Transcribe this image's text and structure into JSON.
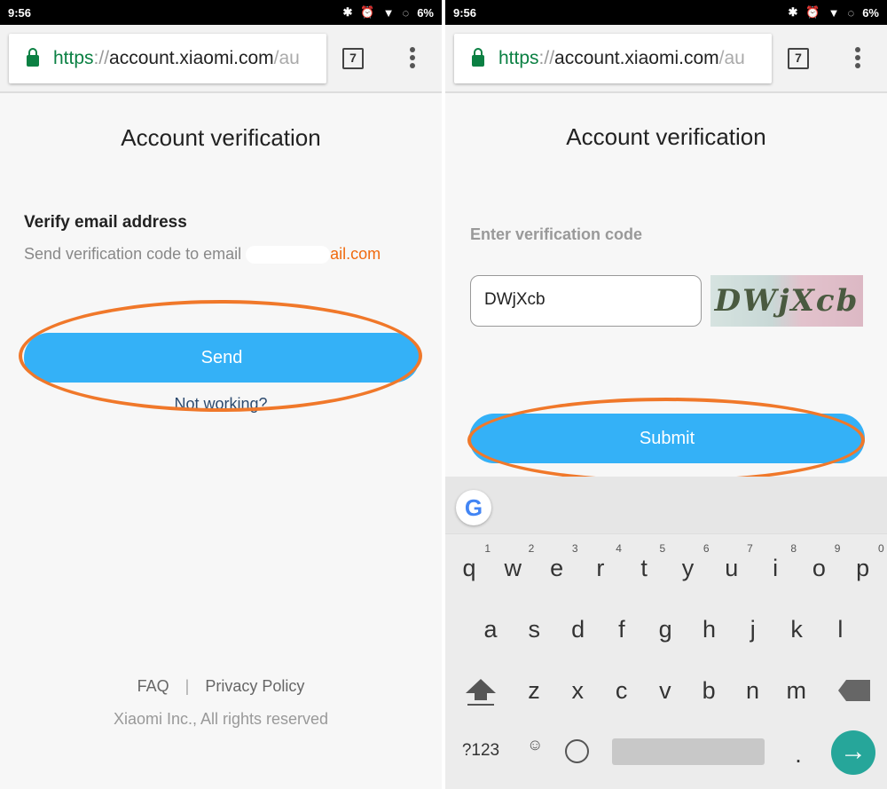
{
  "status": {
    "time": "9:56",
    "battery": "6%"
  },
  "browser": {
    "url_scheme": "https",
    "url_sep": "://",
    "url_host": "account.xiaomi.com",
    "url_rest": "/au",
    "tab_count": "7"
  },
  "left": {
    "title": "Account verification",
    "heading": "Verify email address",
    "desc": "Send verification code to email ",
    "email_visible": "ail.com",
    "send": "Send",
    "not_working": "Not working?",
    "faq": "FAQ",
    "divider": "|",
    "privacy": "Privacy Policy",
    "copyright": "Xiaomi Inc., All rights reserved"
  },
  "right": {
    "title": "Account verification",
    "label": "Enter verification code",
    "code_value": "DWjXcb",
    "captcha_text": "DWjXcb",
    "submit": "Submit"
  },
  "keyboard": {
    "row1": [
      [
        "q",
        "1"
      ],
      [
        "w",
        "2"
      ],
      [
        "e",
        "3"
      ],
      [
        "r",
        "4"
      ],
      [
        "t",
        "5"
      ],
      [
        "y",
        "6"
      ],
      [
        "u",
        "7"
      ],
      [
        "i",
        "8"
      ],
      [
        "o",
        "9"
      ],
      [
        "p",
        "0"
      ]
    ],
    "row2": [
      "a",
      "s",
      "d",
      "f",
      "g",
      "h",
      "j",
      "k",
      "l"
    ],
    "row3": [
      "z",
      "x",
      "c",
      "v",
      "b",
      "n",
      "m"
    ],
    "symbols": "?123",
    "period": "."
  },
  "colors": {
    "accent": "#34b1f7",
    "highlight": "#f0782a",
    "email": "#f06a0f"
  }
}
